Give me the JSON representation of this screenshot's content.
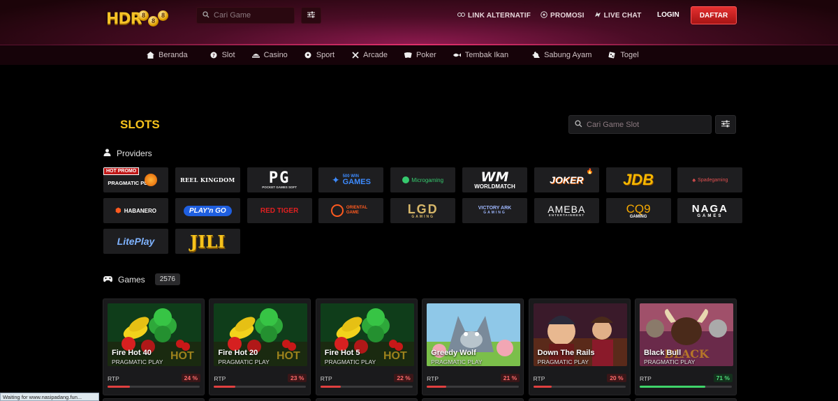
{
  "brand": {
    "logo_text": "HDR",
    "coin_a": "8",
    "coin_b": "8",
    "coin_c": "8"
  },
  "header": {
    "search_placeholder": "Cari Game",
    "links": [
      {
        "label": "LINK ALTERNATIF",
        "icon": "link-icon"
      },
      {
        "label": "PROMOSI",
        "icon": "gift-icon"
      },
      {
        "label": "LIVE CHAT",
        "icon": "chat-icon"
      }
    ],
    "login_label": "LOGIN",
    "register_label": "DAFTAR"
  },
  "nav": [
    {
      "label": "Beranda",
      "icon": "home-icon",
      "active": false
    },
    {
      "label": "Slot",
      "icon": "slot-icon",
      "active": true
    },
    {
      "label": "Casino",
      "icon": "casino-icon",
      "active": false
    },
    {
      "label": "Sport",
      "icon": "soccer-icon",
      "active": false
    },
    {
      "label": "Arcade",
      "icon": "arcade-icon",
      "active": false
    },
    {
      "label": "Poker",
      "icon": "poker-icon",
      "active": false
    },
    {
      "label": "Tembak Ikan",
      "icon": "fish-icon",
      "active": false
    },
    {
      "label": "Sabung Ayam",
      "icon": "rooster-icon",
      "active": false
    },
    {
      "label": "Togel",
      "icon": "togel-icon",
      "active": false
    }
  ],
  "slots": {
    "title": "SLOTS",
    "search_placeholder": "Cari Game Slot",
    "providers_label": "Providers",
    "games_label": "Games",
    "games_count": "2576"
  },
  "providers": [
    {
      "name": "PRAGMATIC PLAY",
      "badge": "HOT PROMO",
      "color": "#ffffff"
    },
    {
      "name": "REEL KINGDOM",
      "color": "#ffffff"
    },
    {
      "name": "PG",
      "sub": "POCKET GAMES SOFT",
      "color": "#ffffff"
    },
    {
      "name": "GAMES",
      "sub": "500 WIN",
      "color": "#3d8bff"
    },
    {
      "name": "Microgaming",
      "color": "#36c96e"
    },
    {
      "name": "WM",
      "sub": "WORLDMATCH",
      "color": "#ffffff"
    },
    {
      "name": "JOKER",
      "color": "#ffffff"
    },
    {
      "name": "JDB",
      "color": "#f5b800"
    },
    {
      "name": "Spadegaming",
      "color": "#e05050"
    },
    {
      "name": "HABANERO",
      "color": "#ffffff"
    },
    {
      "name": "PLAY'n GO",
      "color": "#3f7bff"
    },
    {
      "name": "RED TIGER",
      "color": "#e02020"
    },
    {
      "name": "ORIENTAL GAME",
      "color": "#ff5a1f"
    },
    {
      "name": "LGD",
      "sub": "GAMING",
      "color": "#d8b86a"
    },
    {
      "name": "VICTORY ARK",
      "sub": "GAMING",
      "color": "#3f7bff"
    },
    {
      "name": "AMEBA",
      "sub": "ENTERTAINMENT",
      "color": "#ffffff"
    },
    {
      "name": "CQ9",
      "sub": "GAMING",
      "color": "#f5a800"
    },
    {
      "name": "NAGA",
      "sub": "GAMES",
      "color": "#ffffff"
    },
    {
      "name": "LitePlay",
      "color": "#7fb3ff"
    },
    {
      "name": "JILI",
      "color": "#f5c21c"
    }
  ],
  "games": [
    {
      "name": "Fire Hot 40",
      "provider": "PRAGMATIC PLAY",
      "rtp_label": "RTP",
      "rtp": "24 %",
      "rtp_value": 24,
      "art": "fruits"
    },
    {
      "name": "Fire Hot 20",
      "provider": "PRAGMATIC PLAY",
      "rtp_label": "RTP",
      "rtp": "23 %",
      "rtp_value": 23,
      "art": "fruits"
    },
    {
      "name": "Fire Hot 5",
      "provider": "PRAGMATIC PLAY",
      "rtp_label": "RTP",
      "rtp": "22 %",
      "rtp_value": 22,
      "art": "fruits"
    },
    {
      "name": "Greedy Wolf",
      "provider": "PRAGMATIC PLAY",
      "rtp_label": "RTP",
      "rtp": "21 %",
      "rtp_value": 21,
      "art": "wolf"
    },
    {
      "name": "Down The Rails",
      "provider": "PRAGMATIC PLAY",
      "rtp_label": "RTP",
      "rtp": "20 %",
      "rtp_value": 20,
      "art": "rails"
    },
    {
      "name": "Black Bull",
      "provider": "PRAGMATIC PLAY",
      "rtp_label": "RTP",
      "rtp": "71 %",
      "rtp_value": 71,
      "art": "bull"
    }
  ],
  "status_text": "Waiting for www.nasipadang.fun..."
}
